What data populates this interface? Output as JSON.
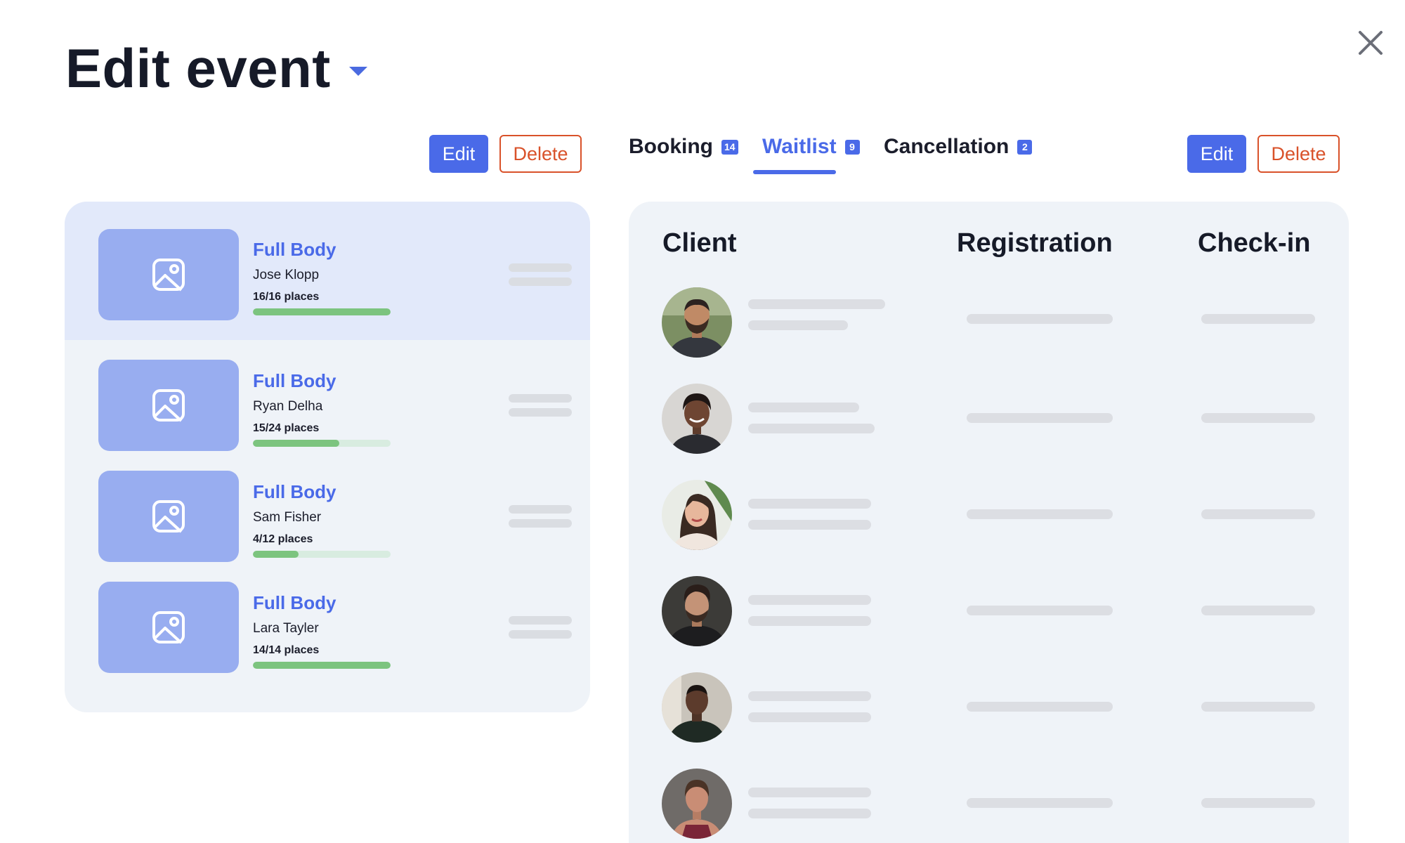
{
  "header": {
    "title": "Edit event"
  },
  "left_actions": {
    "edit_label": "Edit",
    "delete_label": "Delete"
  },
  "right_actions": {
    "edit_label": "Edit",
    "delete_label": "Delete"
  },
  "tabs": [
    {
      "label": "Booking",
      "count": "14",
      "active": false
    },
    {
      "label": "Waitlist",
      "count": "9",
      "active": true
    },
    {
      "label": "Cancellation",
      "count": "2",
      "active": false
    }
  ],
  "events": [
    {
      "title": "Full Body",
      "instructor": "Jose Klopp",
      "places": "16/16 places",
      "fill": 1.0,
      "selected": true
    },
    {
      "title": "Full Body",
      "instructor": "Ryan Delha",
      "places": "15/24 places",
      "fill": 0.625,
      "selected": false
    },
    {
      "title": "Full Body",
      "instructor": "Sam Fisher",
      "places": "4/12 places",
      "fill": 0.333,
      "selected": false
    },
    {
      "title": "Full Body",
      "instructor": "Lara Tayler",
      "places": "14/14 places",
      "fill": 1.0,
      "selected": false
    }
  ],
  "table": {
    "columns": [
      "Client",
      "Registration",
      "Check-in"
    ],
    "rows": [
      {
        "avatar": "avatar-man-beard-outdoor"
      },
      {
        "avatar": "avatar-woman-smiling"
      },
      {
        "avatar": "avatar-woman-long-hair"
      },
      {
        "avatar": "avatar-man-styled-hair"
      },
      {
        "avatar": "avatar-man-gym"
      },
      {
        "avatar": "avatar-woman-athletic"
      }
    ]
  },
  "colors": {
    "accent": "#4a6ae8",
    "danger": "#d9522a",
    "progress": "#7cc47f",
    "panel": "#eff3f8",
    "selected_card": "#e2e9fa",
    "thumb": "#98adf0"
  }
}
